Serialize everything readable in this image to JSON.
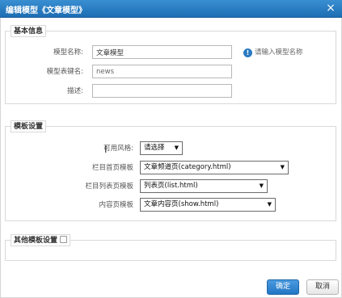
{
  "dialog": {
    "title": "编辑模型《文章模型》",
    "close_icon": "×"
  },
  "basic_info": {
    "legend": "基本信息",
    "model_name": {
      "label": "模型名称:",
      "value": "文章模型"
    },
    "hint": "请输入模型名称",
    "table_name": {
      "label": "模型表键名:",
      "value": "news"
    },
    "description": {
      "label": "描述:",
      "value": ""
    }
  },
  "template_settings": {
    "legend": "模板设置",
    "style": {
      "label": "可用风格:",
      "selected": "请选择"
    },
    "column_home": {
      "label": "栏目首页模板",
      "selected": "文章频道页(category.html)"
    },
    "column_list": {
      "label": "栏目列表页模板",
      "selected": "列表页(list.html)"
    },
    "content": {
      "label": "内容页模板",
      "selected": "文章内容页(show.html)"
    }
  },
  "other_settings": {
    "legend": "其他模板设置"
  },
  "buttons": {
    "ok": "确定",
    "cancel": "取消"
  },
  "colors": {
    "titlebar": "#1d6db3",
    "primary_button": "#2275c4",
    "info_icon": "#2a7ac2"
  },
  "icons": {
    "close": "close-icon",
    "info": "info-icon",
    "select_arrow": "chevron-down-icon",
    "cursor": "text-cursor-icon"
  }
}
